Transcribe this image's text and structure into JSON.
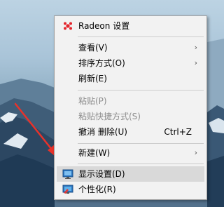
{
  "menu": {
    "radeon": "Radeon 设置",
    "view": "查看(V)",
    "sort": "排序方式(O)",
    "refresh": "刷新(E)",
    "paste": "粘贴(P)",
    "paste_shortcut": "粘贴快捷方式(S)",
    "undo_delete": "撤消 删除(U)",
    "undo_shortcut": "Ctrl+Z",
    "new": "新建(W)",
    "display": "显示设置(D)",
    "personalize": "个性化(R)",
    "submenu_glyph": "›"
  },
  "icons": {
    "radeon": "radeon-icon",
    "display": "display-settings-icon",
    "personalize": "personalize-icon"
  },
  "colors": {
    "menu_bg": "#f2f2f2",
    "highlight": "#d9d9d9",
    "disabled_text": "#8d8d8d",
    "radeon_red": "#e3242b",
    "arrow_red": "#e8322a"
  }
}
